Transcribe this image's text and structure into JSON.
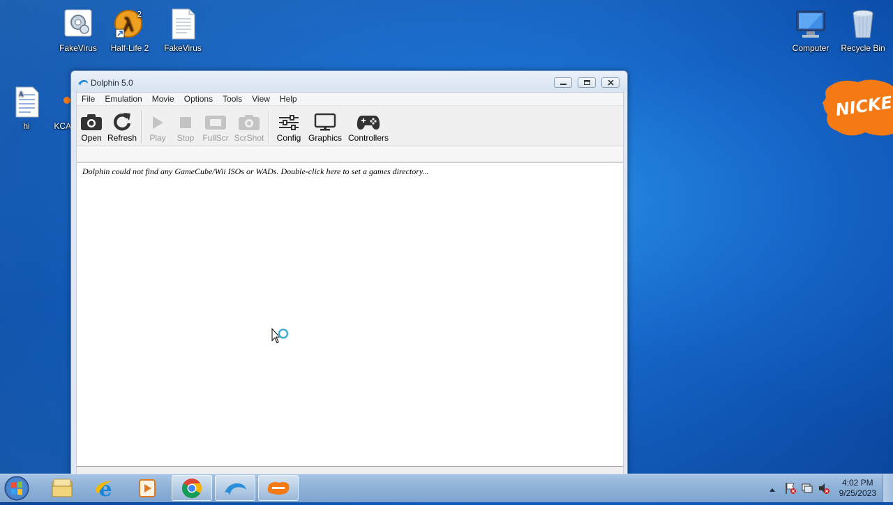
{
  "desktop": {
    "icons": [
      {
        "label": "FakeVirus",
        "name": "fakevirus-settings-icon"
      },
      {
        "label": "Half-Life 2",
        "name": "half-life-2-icon"
      },
      {
        "label": "FakeVirus",
        "name": "fakevirus-file-icon"
      },
      {
        "label": "Computer",
        "name": "computer-icon"
      },
      {
        "label": "Recycle Bin",
        "name": "recycle-bin-icon"
      },
      {
        "label": "hi",
        "name": "document-icon"
      },
      {
        "label": "KCA",
        "name": "kca-icon"
      }
    ],
    "nick_text": "NICKELO"
  },
  "window": {
    "title": "Dolphin 5.0",
    "menu": [
      "File",
      "Emulation",
      "Movie",
      "Options",
      "Tools",
      "View",
      "Help"
    ],
    "toolbar": {
      "open": "Open",
      "refresh": "Refresh",
      "play": "Play",
      "stop": "Stop",
      "fullscr": "FullScr",
      "scrshot": "ScrShot",
      "config": "Config",
      "graphics": "Graphics",
      "controllers": "Controllers"
    },
    "message": "Dolphin could not find any GameCube/Wii ISOs or WADs. Double-click here to set a games directory..."
  },
  "taskbar": {
    "items": [
      "start",
      "file-explorer",
      "internet-explorer",
      "media-player",
      "chrome",
      "dolphin",
      "nickelodeon"
    ],
    "clock": {
      "time": "4:02 PM",
      "date": "9/25/2023"
    }
  },
  "colors": {
    "accent": "#1667c9",
    "nick_orange": "#f57a14"
  }
}
